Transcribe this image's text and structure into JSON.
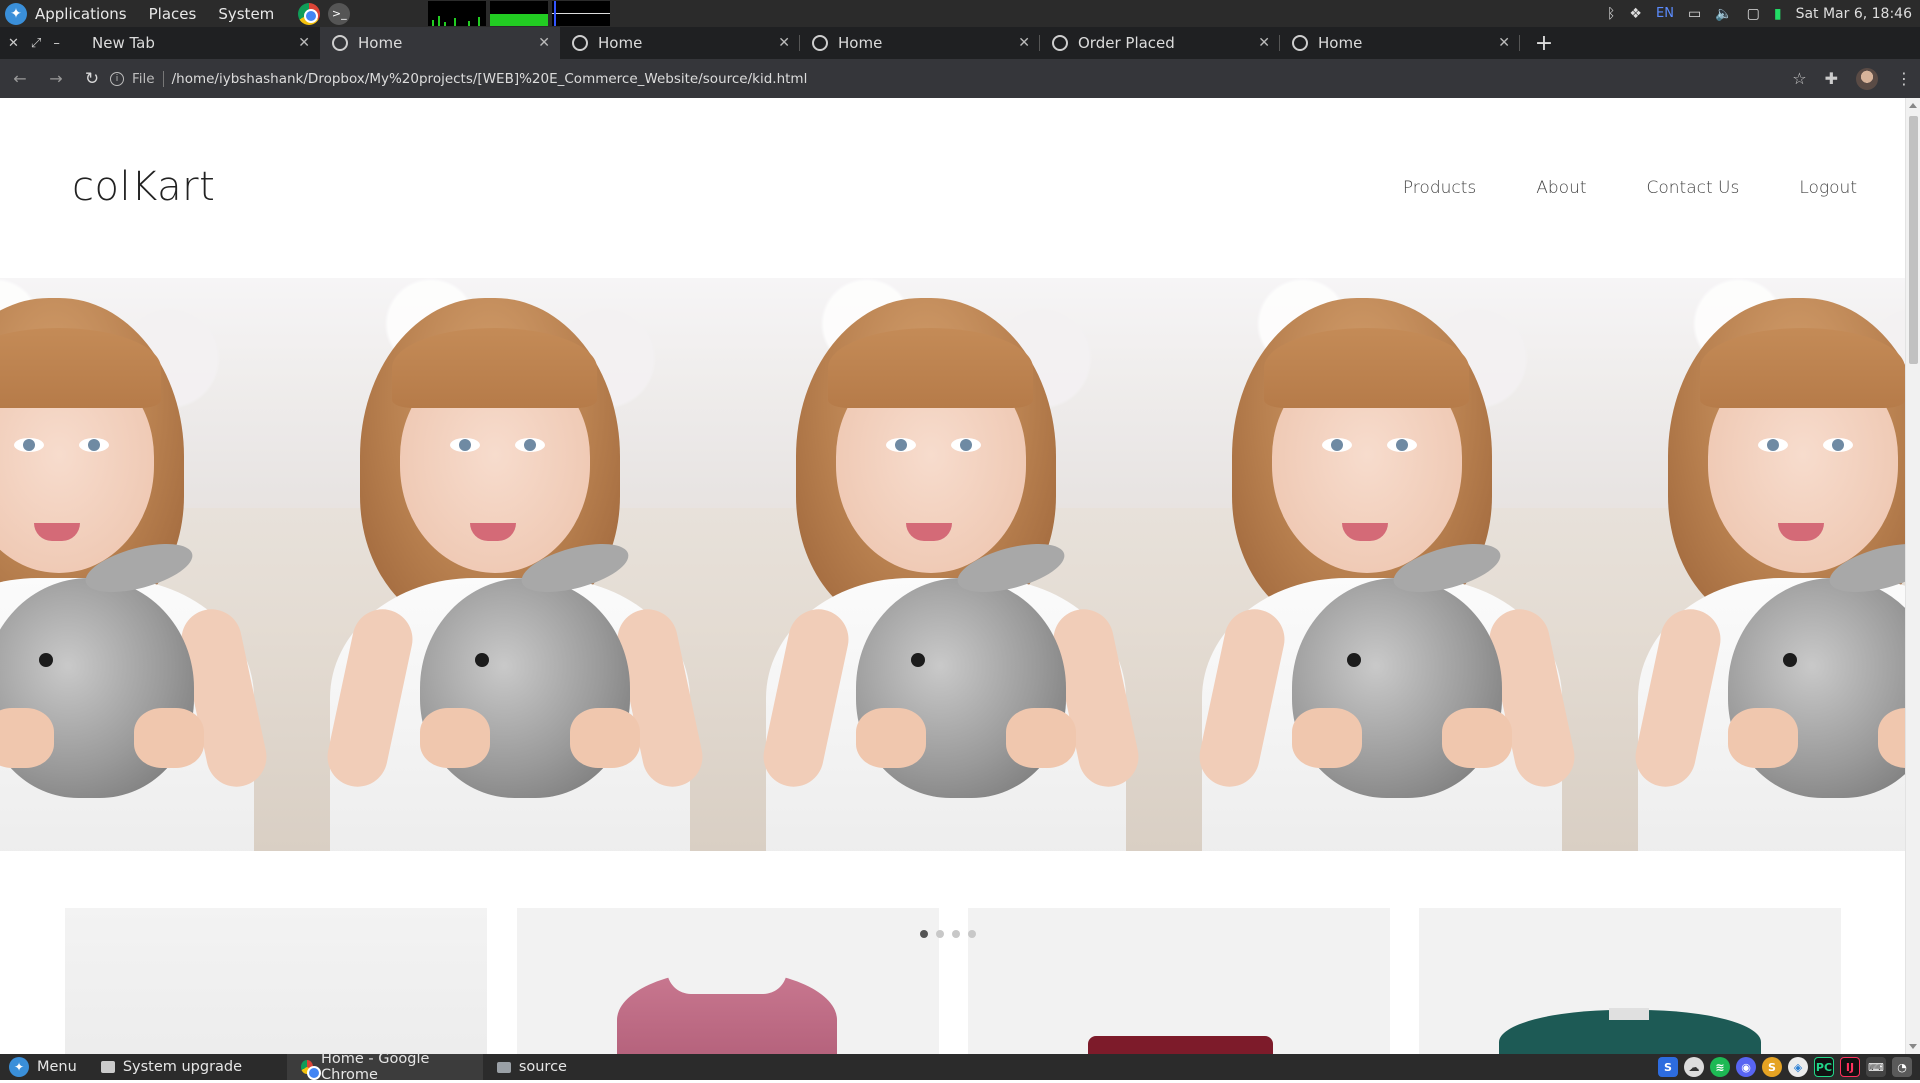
{
  "system_panel": {
    "menus": [
      "Applications",
      "Places",
      "System"
    ],
    "keyboard_layout": "EN",
    "clock": "Sat Mar  6, 18:46"
  },
  "browser": {
    "tabs": [
      {
        "title": "New Tab",
        "active": false
      },
      {
        "title": "Home",
        "active": true
      },
      {
        "title": "Home",
        "active": false
      },
      {
        "title": "Home",
        "active": false
      },
      {
        "title": "Order Placed",
        "active": false
      },
      {
        "title": "Home",
        "active": false
      }
    ],
    "new_tab_glyph": "+",
    "address": {
      "scheme_label": "File",
      "url": "/home/iybshashank/Dropbox/My%20projects/[WEB]%20E_Commerce_Website/source/kid.html"
    }
  },
  "site": {
    "logo": "colKart",
    "nav": [
      "Products",
      "About",
      "Contact Us",
      "Logout"
    ],
    "carousel": {
      "slide_count": 4,
      "active_index": 0
    },
    "product_cards": 4
  },
  "taskbar": {
    "menu_label": "Menu",
    "items": [
      {
        "label": "System upgrade",
        "active": false
      },
      {
        "label": "Home - Google Chrome",
        "active": true
      },
      {
        "label": "source",
        "active": false
      }
    ]
  },
  "colors": {
    "panel_bg": "#2b2b2b",
    "tab_active_bg": "#35363a",
    "accent_blue": "#3a8fd9"
  }
}
